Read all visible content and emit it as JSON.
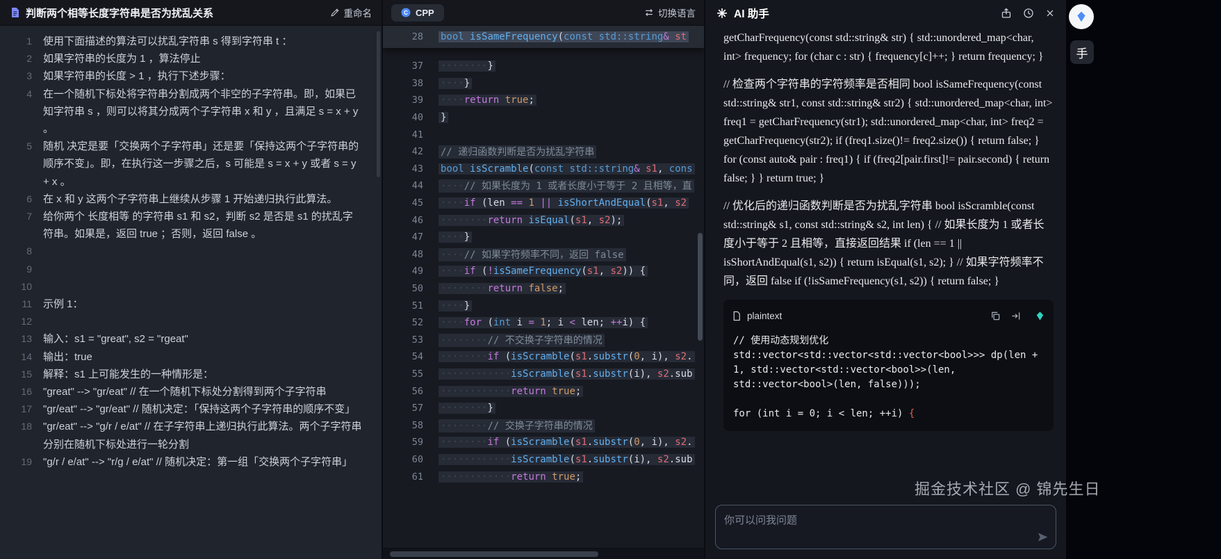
{
  "watermark": "掘金技术社区 @ 锦先生日",
  "floating": {
    "tab_label": "手"
  },
  "colors": {
    "typ": "#569cd6",
    "ctl": "#c678dd",
    "fn": "#61afef",
    "num": "#d19a66",
    "prm": "#e06c75",
    "cm": "#7f8c98",
    "pl": "#d8dce4",
    "ws": "#3f4654",
    "red": "#e35f55",
    "gem": "#2dd4bf"
  },
  "problem": {
    "title": "判断两个相等长度字符串是否为扰乱关系",
    "rename_label": "重命名",
    "lines": [
      {
        "num": "1",
        "text": "使用下面描述的算法可以扰乱字符串 s 得到字符串 t ："
      },
      {
        "num": "2",
        "text": "如果字符串的长度为 1 ，算法停止"
      },
      {
        "num": "3",
        "text": "如果字符串的长度 > 1 ，执行下述步骤："
      },
      {
        "num": "4",
        "text": "在一个随机下标处将字符串分割成两个非空的子字符串。即，如果已知字符串 s ，则可以将其分成两个子字符串 x 和 y ，且满足 s = x + y 。"
      },
      {
        "num": "5",
        "text": "随机 决定是要「交换两个子字符串」还是要「保持这两个子字符串的顺序不变」。即，在执行这一步骤之后，s 可能是 s = x + y 或者 s = y + x 。"
      },
      {
        "num": "6",
        "text": "在 x 和 y 这两个子字符串上继续从步骤 1 开始递归执行此算法。"
      },
      {
        "num": "7",
        "text": "给你两个 长度相等 的字符串 s1 和 s2，判断 s2 是否是 s1 的扰乱字符串。如果是，返回 true ；否则，返回 false 。"
      },
      {
        "num": "8",
        "text": ""
      },
      {
        "num": "9",
        "text": ""
      },
      {
        "num": "10",
        "text": ""
      },
      {
        "num": "11",
        "text": "示例 1："
      },
      {
        "num": "12",
        "text": ""
      },
      {
        "num": "13",
        "text": "输入：s1 = \"great\", s2 = \"rgeat\""
      },
      {
        "num": "14",
        "text": "输出：true"
      },
      {
        "num": "15",
        "text": "解释：s1 上可能发生的一种情形是："
      },
      {
        "num": "16",
        "text": "\"great\" --> \"gr/eat\" // 在一个随机下标处分割得到两个子字符串"
      },
      {
        "num": "17",
        "text": "\"gr/eat\" --> \"gr/eat\" // 随机决定：「保持这两个子字符串的顺序不变」"
      },
      {
        "num": "18",
        "text": "\"gr/eat\" --> \"g/r / e/at\" // 在子字符串上递归执行此算法。两个子字符串分别在随机下标处进行一轮分割"
      },
      {
        "num": "19",
        "text": "\"g/r / e/at\" --> \"r/g / e/at\" // 随机决定：第一组「交换两个子字符串」"
      }
    ]
  },
  "editor": {
    "tab_label": "CPP",
    "switch_label": "切换语言",
    "sticky_line": {
      "num": "28",
      "tokens": [
        [
          "typ",
          "bool"
        ],
        [
          "pl",
          " "
        ],
        [
          "fn",
          "isSameFrequency"
        ],
        [
          "pl",
          "("
        ],
        [
          "typ",
          "const"
        ],
        [
          "pl",
          " "
        ],
        [
          "typ",
          "std::string"
        ],
        [
          "ctl",
          "&"
        ],
        [
          "pl",
          " "
        ],
        [
          "prm",
          "st"
        ]
      ]
    },
    "lines": [
      {
        "num": "37",
        "tokens": [
          [
            "ws",
            "········"
          ],
          [
            "pl",
            "}"
          ]
        ]
      },
      {
        "num": "38",
        "tokens": [
          [
            "ws",
            "····"
          ],
          [
            "pl",
            "}"
          ]
        ]
      },
      {
        "num": "39",
        "tokens": [
          [
            "ws",
            "····"
          ],
          [
            "ctl",
            "return"
          ],
          [
            "pl",
            " "
          ],
          [
            "num",
            "true"
          ],
          [
            "pl",
            ";"
          ]
        ]
      },
      {
        "num": "40",
        "tokens": [
          [
            "pl",
            "}"
          ]
        ]
      },
      {
        "num": "41",
        "tokens": []
      },
      {
        "num": "42",
        "tokens": [
          [
            "cm",
            "// 递归函数判断是否为扰乱字符串"
          ]
        ]
      },
      {
        "num": "43",
        "tokens": [
          [
            "typ",
            "bool"
          ],
          [
            "pl",
            " "
          ],
          [
            "fn",
            "isScramble"
          ],
          [
            "pl",
            "("
          ],
          [
            "typ",
            "const"
          ],
          [
            "pl",
            " "
          ],
          [
            "typ",
            "std::string"
          ],
          [
            "ctl",
            "&"
          ],
          [
            "pl",
            " "
          ],
          [
            "prm",
            "s1"
          ],
          [
            "pl",
            ", "
          ],
          [
            "typ",
            "cons"
          ]
        ]
      },
      {
        "num": "44",
        "tokens": [
          [
            "ws",
            "····"
          ],
          [
            "cm",
            "// 如果长度为 1 或者长度小于等于 2 且相等，直"
          ]
        ]
      },
      {
        "num": "45",
        "tokens": [
          [
            "ws",
            "····"
          ],
          [
            "ctl",
            "if"
          ],
          [
            "pl",
            " (len "
          ],
          [
            "ctl",
            "=="
          ],
          [
            "pl",
            " "
          ],
          [
            "num",
            "1"
          ],
          [
            "pl",
            " "
          ],
          [
            "ctl",
            "||"
          ],
          [
            "pl",
            " "
          ],
          [
            "fn",
            "isShortAndEqual"
          ],
          [
            "pl",
            "("
          ],
          [
            "prm",
            "s1"
          ],
          [
            "pl",
            ", "
          ],
          [
            "prm",
            "s2"
          ]
        ]
      },
      {
        "num": "46",
        "tokens": [
          [
            "ws",
            "········"
          ],
          [
            "ctl",
            "return"
          ],
          [
            "pl",
            " "
          ],
          [
            "fn",
            "isEqual"
          ],
          [
            "pl",
            "("
          ],
          [
            "prm",
            "s1"
          ],
          [
            "pl",
            ", "
          ],
          [
            "prm",
            "s2"
          ],
          [
            "pl",
            ");"
          ]
        ]
      },
      {
        "num": "47",
        "tokens": [
          [
            "ws",
            "····"
          ],
          [
            "pl",
            "}"
          ]
        ]
      },
      {
        "num": "48",
        "tokens": [
          [
            "ws",
            "····"
          ],
          [
            "cm",
            "// 如果字符频率不同，返回 false"
          ]
        ]
      },
      {
        "num": "49",
        "tokens": [
          [
            "ws",
            "····"
          ],
          [
            "ctl",
            "if"
          ],
          [
            "pl",
            " ("
          ],
          [
            "ctl",
            "!"
          ],
          [
            "fn",
            "isSameFrequency"
          ],
          [
            "pl",
            "("
          ],
          [
            "prm",
            "s1"
          ],
          [
            "pl",
            ", "
          ],
          [
            "prm",
            "s2"
          ],
          [
            "pl",
            ")) {"
          ]
        ]
      },
      {
        "num": "50",
        "tokens": [
          [
            "ws",
            "········"
          ],
          [
            "ctl",
            "return"
          ],
          [
            "pl",
            " "
          ],
          [
            "num",
            "false"
          ],
          [
            "pl",
            ";"
          ]
        ]
      },
      {
        "num": "51",
        "tokens": [
          [
            "ws",
            "····"
          ],
          [
            "pl",
            "}"
          ]
        ]
      },
      {
        "num": "52",
        "tokens": [
          [
            "ws",
            "····"
          ],
          [
            "ctl",
            "for"
          ],
          [
            "pl",
            " ("
          ],
          [
            "typ",
            "int"
          ],
          [
            "pl",
            " i "
          ],
          [
            "ctl",
            "="
          ],
          [
            "pl",
            " "
          ],
          [
            "num",
            "1"
          ],
          [
            "pl",
            "; i "
          ],
          [
            "ctl",
            "<"
          ],
          [
            "pl",
            " len; "
          ],
          [
            "ctl",
            "++"
          ],
          [
            "pl",
            "i) {"
          ]
        ]
      },
      {
        "num": "53",
        "tokens": [
          [
            "ws",
            "········"
          ],
          [
            "cm",
            "// 不交换子字符串的情况"
          ]
        ]
      },
      {
        "num": "54",
        "tokens": [
          [
            "ws",
            "········"
          ],
          [
            "ctl",
            "if"
          ],
          [
            "pl",
            " ("
          ],
          [
            "fn",
            "isScramble"
          ],
          [
            "pl",
            "("
          ],
          [
            "prm",
            "s1"
          ],
          [
            "pl",
            "."
          ],
          [
            "fn",
            "substr"
          ],
          [
            "pl",
            "("
          ],
          [
            "num",
            "0"
          ],
          [
            "pl",
            ", i), "
          ],
          [
            "prm",
            "s2"
          ],
          [
            "pl",
            "."
          ]
        ]
      },
      {
        "num": "55",
        "tokens": [
          [
            "ws",
            "············"
          ],
          [
            "fn",
            "isScramble"
          ],
          [
            "pl",
            "("
          ],
          [
            "prm",
            "s1"
          ],
          [
            "pl",
            "."
          ],
          [
            "fn",
            "substr"
          ],
          [
            "pl",
            "(i), "
          ],
          [
            "prm",
            "s2"
          ],
          [
            "pl",
            ".sub"
          ]
        ]
      },
      {
        "num": "56",
        "tokens": [
          [
            "ws",
            "············"
          ],
          [
            "ctl",
            "return"
          ],
          [
            "pl",
            " "
          ],
          [
            "num",
            "true"
          ],
          [
            "pl",
            ";"
          ]
        ]
      },
      {
        "num": "57",
        "tokens": [
          [
            "ws",
            "········"
          ],
          [
            "pl",
            "}"
          ]
        ]
      },
      {
        "num": "58",
        "tokens": [
          [
            "ws",
            "········"
          ],
          [
            "cm",
            "// 交换子字符串的情况"
          ]
        ]
      },
      {
        "num": "59",
        "tokens": [
          [
            "ws",
            "········"
          ],
          [
            "ctl",
            "if"
          ],
          [
            "pl",
            " ("
          ],
          [
            "fn",
            "isScramble"
          ],
          [
            "pl",
            "("
          ],
          [
            "prm",
            "s1"
          ],
          [
            "pl",
            "."
          ],
          [
            "fn",
            "substr"
          ],
          [
            "pl",
            "("
          ],
          [
            "num",
            "0"
          ],
          [
            "pl",
            ", i), "
          ],
          [
            "prm",
            "s2"
          ],
          [
            "pl",
            "."
          ]
        ]
      },
      {
        "num": "60",
        "tokens": [
          [
            "ws",
            "············"
          ],
          [
            "fn",
            "isScramble"
          ],
          [
            "pl",
            "("
          ],
          [
            "prm",
            "s1"
          ],
          [
            "pl",
            "."
          ],
          [
            "fn",
            "substr"
          ],
          [
            "pl",
            "(i), "
          ],
          [
            "prm",
            "s2"
          ],
          [
            "pl",
            ".sub"
          ]
        ]
      },
      {
        "num": "61",
        "tokens": [
          [
            "ws",
            "············"
          ],
          [
            "ctl",
            "return"
          ],
          [
            "pl",
            " "
          ],
          [
            "num",
            "true"
          ],
          [
            "pl",
            ";"
          ]
        ]
      }
    ]
  },
  "assistant": {
    "title": "AI 助手",
    "paragraphs": [
      "getCharFrequency(const std::string& str) { std::unordered_map<char, int> frequency; for (char c : str) { frequency[c]++; } return frequency; }",
      "// 检查两个字符串的字符频率是否相同 bool isSameFrequency(const std::string& str1, const std::string& str2) { std::unordered_map<char, int> freq1 = getCharFrequency(str1); std::unordered_map<char, int> freq2 = getCharFrequency(str2); if (freq1.size()!= freq2.size()) { return false; } for (const auto& pair : freq1) { if (freq2[pair.first]!= pair.second) { return false; } } return true; }",
      "// 优化后的递归函数判断是否为扰乱字符串 bool isScramble(const std::string& s1, const std::string& s2, int len) { // 如果长度为 1 或者长度小于等于 2 且相等，直接返回结果 if (len == 1 || isShortAndEqual(s1, s2)) { return isEqual(s1, s2); } // 如果字符频率不同，返回 false if (!isSameFrequency(s1, s2)) { return false; }"
    ],
    "code_block": {
      "lang": "plaintext",
      "lines": [
        [
          [
            "cw",
            "// 使用动态规划优化"
          ]
        ],
        [
          [
            "cw",
            "std::vector<std::vector<std::vector<bool>>> dp(len + 1, std::vector<std::vector<bool>>(len, std::vector<bool>(len, false)));"
          ]
        ],
        [
          [
            "cw",
            ""
          ]
        ],
        [
          [
            "cw",
            "for (int i = 0; i < len; ++i) "
          ],
          [
            "red",
            "{"
          ]
        ]
      ]
    },
    "input_placeholder": "你可以问我问题"
  }
}
